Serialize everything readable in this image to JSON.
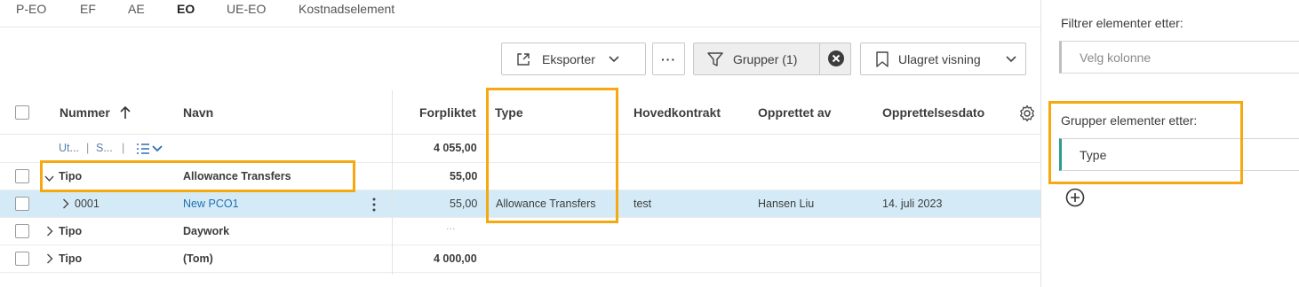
{
  "tabs": [
    "P-EO",
    "EF",
    "AE",
    "EO",
    "UE-EO",
    "Kostnadselement"
  ],
  "active_tab": "EO",
  "toolbar": {
    "export_label": "Eksporter",
    "more_label": "···",
    "group_label": "Grupper (1)",
    "view_label": "Ulagret visning"
  },
  "columns": {
    "number": "Nummer",
    "name": "Navn",
    "committed": "Forpliktet",
    "type": "Type",
    "main_contract": "Hovedkontrakt",
    "created_by": "Opprettet av",
    "created_date": "Opprettelsesdato"
  },
  "summary": {
    "filter_a": "Ut...",
    "filter_b": "S...",
    "total": "4 055,00"
  },
  "rows": [
    {
      "group_label": "Tipo",
      "name": "Allowance Transfers",
      "committed": "55,00"
    },
    {
      "number": "0001",
      "name": "New PCO1",
      "committed": "55,00",
      "type": "Allowance Transfers",
      "main_contract": "test",
      "created_by": "Hansen Liu",
      "created_date": "14. juli 2023"
    },
    {
      "group_label": "Tipo",
      "name": "Daywork",
      "committed": "..."
    },
    {
      "group_label": "Tipo",
      "name": "(Tom)",
      "committed": "4 000,00"
    }
  ],
  "panel": {
    "filter_label": "Filtrer elementer etter:",
    "filter_placeholder": "Velg kolonne",
    "group_label": "Grupper elementer etter:",
    "group_value": "Type"
  },
  "colors": {
    "accent": "#f5a80f",
    "selected_row": "#d4ebf7",
    "link": "#1f6fb2"
  }
}
